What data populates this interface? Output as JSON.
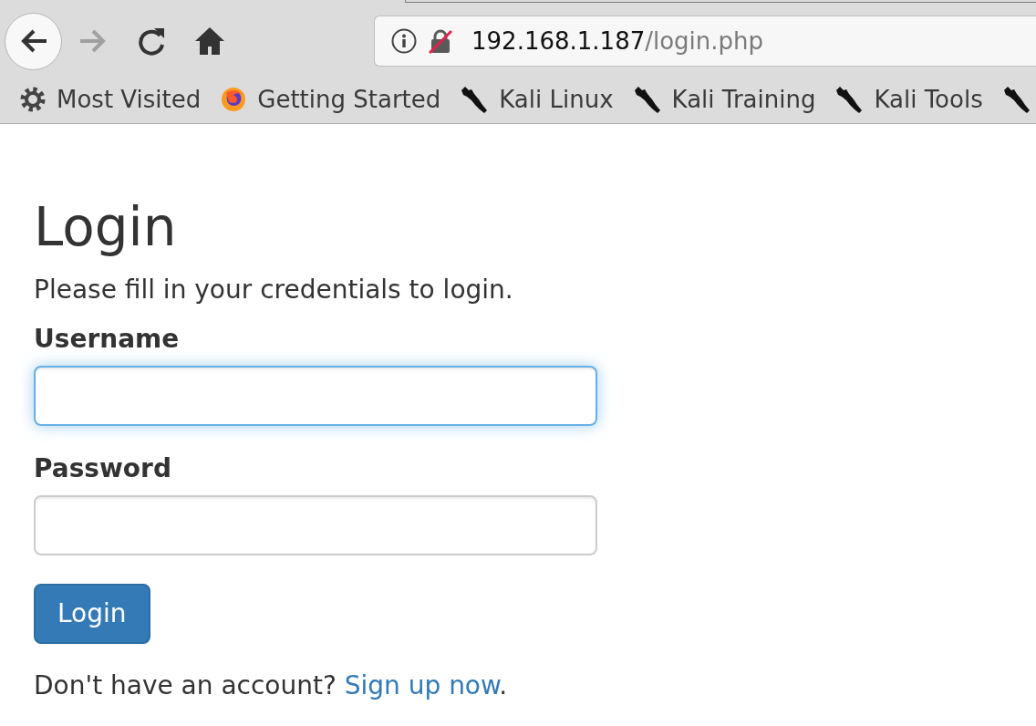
{
  "browser": {
    "nav_buttons": [
      {
        "kind": "back",
        "disabled": false
      },
      {
        "kind": "forward",
        "disabled": true
      },
      {
        "kind": "reload",
        "disabled": false
      },
      {
        "kind": "home",
        "disabled": false
      }
    ],
    "address_bar": {
      "host": "192.168.1.187",
      "path": "/login.php",
      "insecure": true
    },
    "bookmarks": [
      {
        "kind": "smart_folder",
        "label": "Most Visited"
      },
      {
        "kind": "browser_page",
        "label": "Getting Started"
      },
      {
        "kind": "kali",
        "label": "Kali Linux"
      },
      {
        "kind": "kali",
        "label": "Kali Training"
      },
      {
        "kind": "kali",
        "label": "Kali Tools"
      },
      {
        "kind": "kali"
      }
    ]
  },
  "page": {
    "title": "Login",
    "intro": "Please fill in your credentials to login.",
    "fields": [
      {
        "label": "Username",
        "focused": true
      },
      {
        "label": "Password",
        "focused": false
      }
    ],
    "submit": "Login",
    "footer": {
      "prompt": "Don't have an account?",
      "link": "Sign up now",
      "end": "."
    }
  }
}
